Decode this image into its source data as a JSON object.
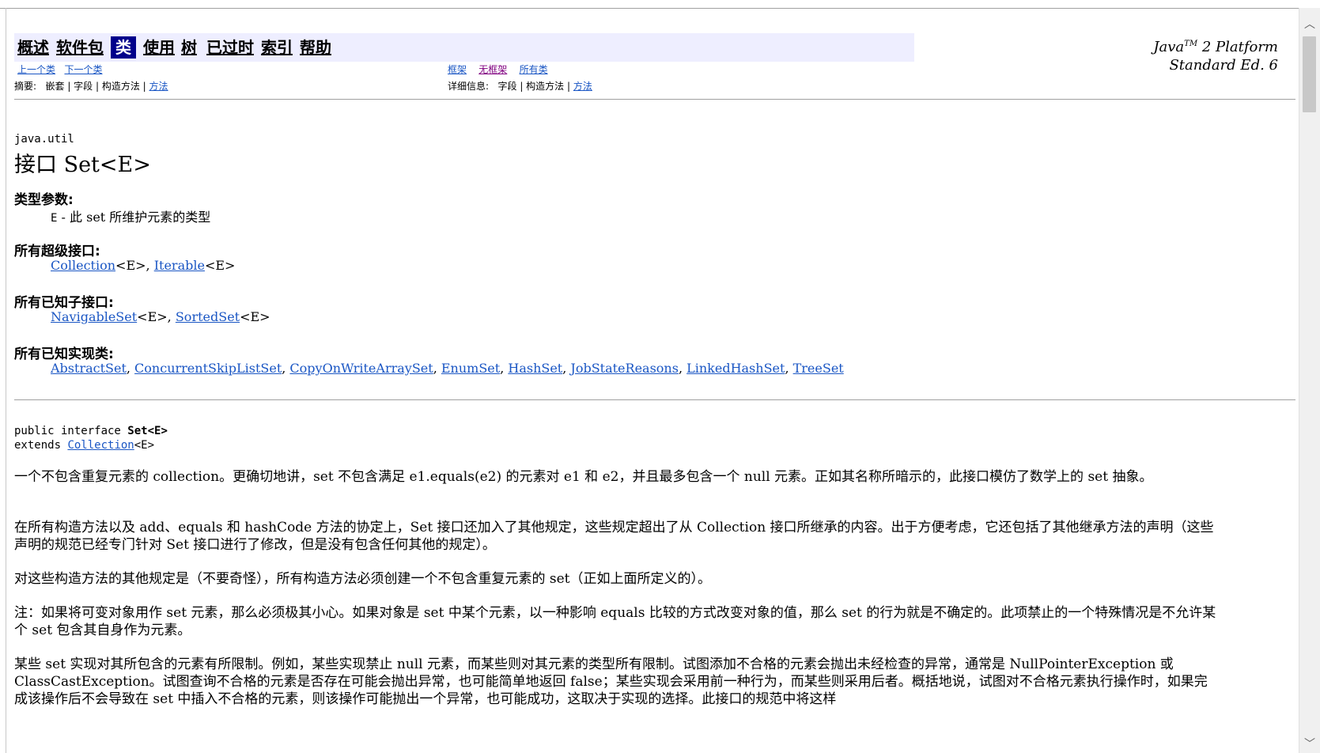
{
  "nav": {
    "items": [
      "概述",
      "软件包",
      "类",
      "使用",
      "树",
      "已过时",
      "索引",
      "帮助"
    ],
    "current_index": 2
  },
  "platform": {
    "line1_prefix": "Java",
    "line1_sup": "TM",
    "line1_suffix": " 2 Platform",
    "line2": "Standard Ed. 6"
  },
  "subnav": {
    "prev_class": "上一个类",
    "next_class": "下一个类",
    "frames": "框架",
    "no_frames": "无框架",
    "all_classes": "所有类",
    "summary_label": "摘要:",
    "summary_items": "嵌套 | 字段 | 构造方法 |",
    "summary_link": "方法",
    "detail_label": "详细信息:",
    "detail_items": "字段 | 构造方法 |",
    "detail_link": "方法"
  },
  "header": {
    "package": "java.util",
    "title": "接口 Set<E>"
  },
  "type_params": {
    "heading": "类型参数:",
    "name": "E",
    "desc": " - 此 set 所维护元素的类型"
  },
  "superinterfaces": {
    "heading": "所有超级接口:",
    "items": [
      "Collection",
      "Iterable"
    ]
  },
  "subinterfaces": {
    "heading": "所有已知子接口:",
    "items": [
      "NavigableSet",
      "SortedSet"
    ]
  },
  "implementing": {
    "heading": "所有已知实现类:",
    "items": [
      "AbstractSet",
      "ConcurrentSkipListSet",
      "CopyOnWriteArraySet",
      "EnumSet",
      "HashSet",
      "JobStateReasons",
      "LinkedHashSet",
      "TreeSet"
    ]
  },
  "generic_suffix": "<E>",
  "separator": ", ",
  "declaration": {
    "line1_prefix": "public interface ",
    "line1_name": "Set<E>",
    "line2_prefix": "extends ",
    "line2_link": "Collection",
    "line2_suffix": "<E>"
  },
  "paragraphs": {
    "p1": "一个不包含重复元素的 collection。更确切地讲，set 不包含满足 e1.equals(e2) 的元素对 e1 和 e2，并且最多包含一个 null 元素。正如其名称所暗示的，此接口模仿了数学上的 set 抽象。",
    "p2": "在所有构造方法以及 add、equals 和 hashCode 方法的协定上，Set 接口还加入了其他规定，这些规定超出了从 Collection 接口所继承的内容。出于方便考虑，它还包括了其他继承方法的声明（这些声明的规范已经专门针对 Set 接口进行了修改，但是没有包含任何其他的规定）。",
    "p3": "对这些构造方法的其他规定是（不要奇怪），所有构造方法必须创建一个不包含重复元素的 set（正如上面所定义的）。",
    "p4": "注：如果将可变对象用作 set 元素，那么必须极其小心。如果对象是 set 中某个元素，以一种影响 equals 比较的方式改变对象的值，那么 set 的行为就是不确定的。此项禁止的一个特殊情况是不允许某个 set 包含其自身作为元素。",
    "p5": "某些 set 实现对其所包含的元素有所限制。例如，某些实现禁止 null 元素，而某些则对其元素的类型所有限制。试图添加不合格的元素会抛出未经检查的异常，通常是 NullPointerException 或 ClassCastException。试图查询不合格的元素是否存在可能会抛出异常，也可能简单地返回 false；某些实现会采用前一种行为，而某些则采用后者。概括地说，试图对不合格元素执行操作时，如果完成该操作后不会导致在 set 中插入不合格的元素，则该操作可能抛出一个异常，也可能成功，这取决于实现的选择。此接口的规范中将这样"
  },
  "colors": {
    "nav_bg": "#eeeeff",
    "nav_current_bg": "#00008b",
    "link": "#1a56c4",
    "visited": "#800080"
  }
}
